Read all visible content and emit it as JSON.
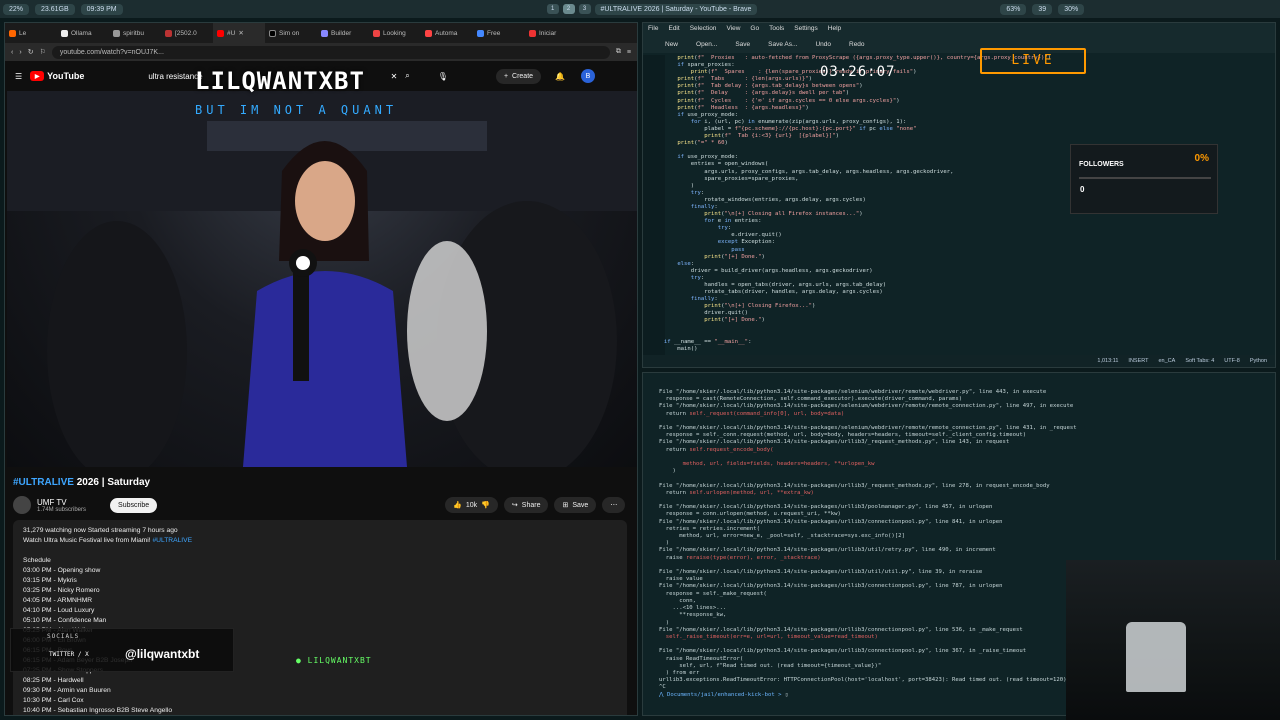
{
  "system_bar": {
    "left_stats": [
      "22%",
      "23.61GB",
      "09:39 PM"
    ],
    "workspaces": [
      "1",
      "2",
      "3"
    ],
    "window_title": "#ULTRALIVE 2026 | Saturday - YouTube - Brave",
    "right_stats": [
      "63%",
      "39",
      "30%"
    ]
  },
  "browser": {
    "tabs": [
      "Le",
      "Ollama",
      "spiritbu",
      "[2502.0",
      "#U",
      "Sim on",
      "Builder",
      "Looking",
      "Automa",
      "Free",
      "Iniciar"
    ],
    "url": "youtube.com/watch?v=nOUJ7K..."
  },
  "youtube": {
    "logo": "YouTube",
    "search_value": "ultra resistance",
    "create_label": "Create",
    "avatar_letter": "B",
    "title_hashtag": "#ULTRALIVE",
    "title_rest": " 2026 | Saturday",
    "channel": "UMF TV",
    "subscribers": "1.74M subscribers",
    "subscribe_label": "Subscribe",
    "likes": "10k",
    "share_label": "Share",
    "save_label": "Save",
    "meta": "31,279 watching now  Started streaming 7 hours ago",
    "desc_line": "Watch Ultra Music Festival live from Miami! ",
    "desc_hashtag": "#ULTRALIVE",
    "schedule_title": "Schedule",
    "schedule": [
      "03:00 PM - Opening show",
      "03:15 PM - Mykris",
      "03:25 PM - Nicky Romero",
      "04:05 PM - ARMNHMR",
      "04:10 PM - Loud Luxury",
      "05:10 PM - Confidence Man",
      "05:25 PM - Alan Walker",
      "06:00 PM - Eli Brown",
      "06:15 PM - Boys",
      "06:15 PM - Adam Beyer B2B Joseph",
      "07:25 PM - Show Stoppers",
      "08:25 PM - Hardwell",
      "09:30 PM - Armin van Buuren",
      "10:30 PM - Carl Cox",
      "10:40 PM - Sebastian Ingrosso B2B Steve Angello"
    ]
  },
  "stream_overlay": {
    "name": "LILQWANTXBT",
    "subtitle": "BUT IM NOT A QUANT",
    "clock": "03:26:07",
    "live": "LIVE",
    "followers_title": "FOLLOWERS",
    "followers_pct": "0%",
    "followers_count": "0",
    "socials_label": "SOCIALS",
    "twitter_label": "TWITTER / X",
    "handle": "@lilqwantxbt",
    "brand_bottom": "LILQWANTXBT"
  },
  "editor": {
    "menu": [
      "File",
      "Edit",
      "Selection",
      "View",
      "Go",
      "Tools",
      "Settings",
      "Help"
    ],
    "toolbar": [
      "New",
      "Open...",
      "Save",
      "Save As...",
      "Undo",
      "Redo"
    ],
    "status": [
      "1,013:11",
      "INSERT",
      "en_CA",
      "Soft Tabs: 4",
      "UTF-8",
      "Python"
    ]
  },
  "terminal": {
    "prompt": "Documents/jail/enhanced-kick-bot > "
  }
}
